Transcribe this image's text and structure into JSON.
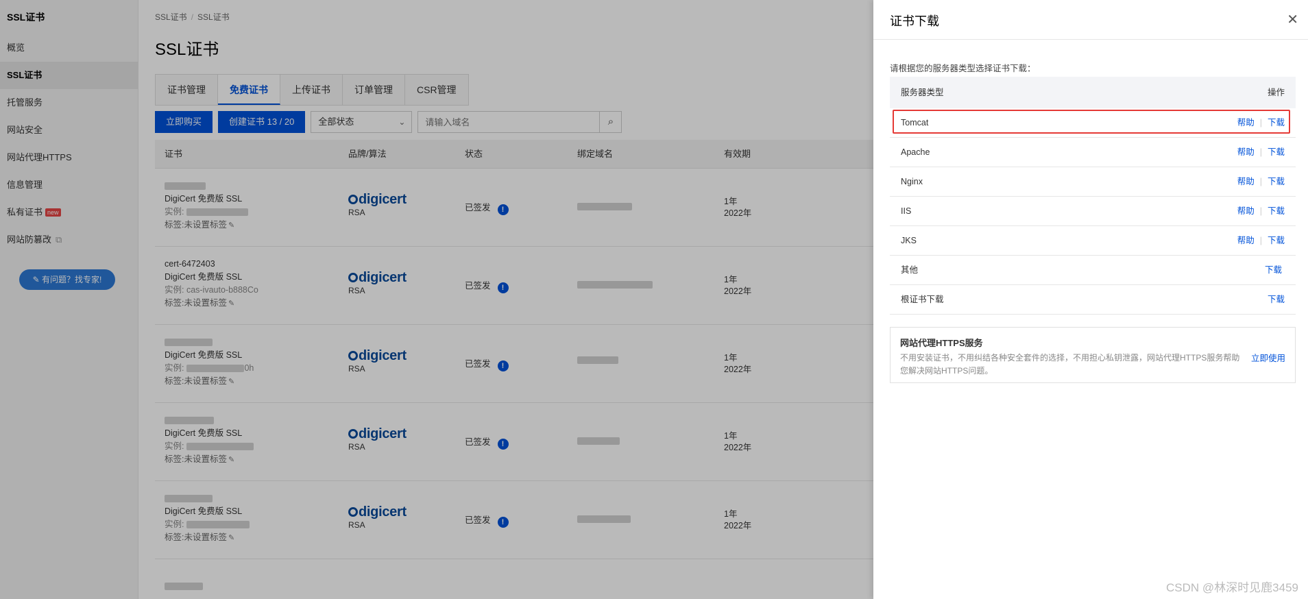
{
  "sidebar": {
    "title": "SSL证书",
    "items": [
      {
        "label": "概览"
      },
      {
        "label": "SSL证书"
      },
      {
        "label": "托管服务"
      },
      {
        "label": "网站安全"
      },
      {
        "label": "网站代理HTTPS"
      },
      {
        "label": "信息管理"
      },
      {
        "label": "私有证书",
        "badge": "new"
      },
      {
        "label": "网站防篡改"
      }
    ],
    "help_button": "有问题？找专家!"
  },
  "main": {
    "breadcrumb": [
      "SSL证书",
      "/",
      "SSL证书"
    ],
    "title": "SSL证书",
    "tabs": [
      "证书管理",
      "免费证书",
      "上传证书",
      "订单管理",
      "CSR管理"
    ],
    "active_tab": "免费证书",
    "toolbar": {
      "buy_label": "立即购买",
      "create_label": "创建证书 13 / 20",
      "status_select": "全部状态",
      "search_placeholder": "请输入域名"
    },
    "table": {
      "headers": [
        "证书",
        "品牌/算法",
        "状态",
        "绑定域名",
        "有效期"
      ],
      "rows": [
        {
          "name": "",
          "product": "DigiCert 免费版 SSL",
          "instance": "实例:",
          "tags": "标签:未设置标签",
          "brand": "digicert",
          "algo": "RSA",
          "status": "已签发",
          "validity": "1年",
          "date": "2022年"
        },
        {
          "name": "cert-6472403",
          "product": "DigiCert 免费版 SSL",
          "instance": "实例: cas-ivauto-b888Co",
          "tags": "标签:未设置标签",
          "brand": "digicert",
          "algo": "RSA",
          "status": "已签发",
          "validity": "1年",
          "date": "2022年"
        },
        {
          "name": "",
          "product": "DigiCert 免费版 SSL",
          "instance": "实例:",
          "instance_tail": "0h",
          "tags": "标签:未设置标签",
          "brand": "digicert",
          "algo": "RSA",
          "status": "已签发",
          "validity": "1年",
          "date": "2022年"
        },
        {
          "name": "",
          "product": "DigiCert 免费版 SSL",
          "instance": "实例:",
          "tags": "标签:未设置标签",
          "brand": "digicert",
          "algo": "RSA",
          "status": "已签发",
          "validity": "1年",
          "date": "2022年"
        },
        {
          "name": "",
          "product": "DigiCert 免费版 SSL",
          "instance": "实例:",
          "tags": "标签:未设置标签",
          "brand": "digicert",
          "algo": "RSA",
          "status": "已签发",
          "validity": "1年",
          "date": "2022年"
        }
      ]
    }
  },
  "drawer": {
    "title": "证书下载",
    "hint": "请根据您的服务器类型选择证书下载：",
    "header_type": "服务器类型",
    "header_op": "操作",
    "help_label": "帮助",
    "download_label": "下载",
    "rows": [
      {
        "name": "Tomcat",
        "has_help": true,
        "highlighted": true
      },
      {
        "name": "Apache",
        "has_help": true
      },
      {
        "name": "Nginx",
        "has_help": true
      },
      {
        "name": "IIS",
        "has_help": true
      },
      {
        "name": "JKS",
        "has_help": true
      },
      {
        "name": "其他",
        "has_help": false
      },
      {
        "name": "根证书下载",
        "has_help": false
      }
    ],
    "promo": {
      "title": "网站代理HTTPS服务",
      "desc": "不用安装证书，不用纠结各种安全套件的选择，不用担心私钥泄露，网站代理HTTPS服务帮助您解决网站HTTPS问题。",
      "link": "立即使用"
    }
  },
  "watermark": "CSDN @林深时见鹿3459"
}
